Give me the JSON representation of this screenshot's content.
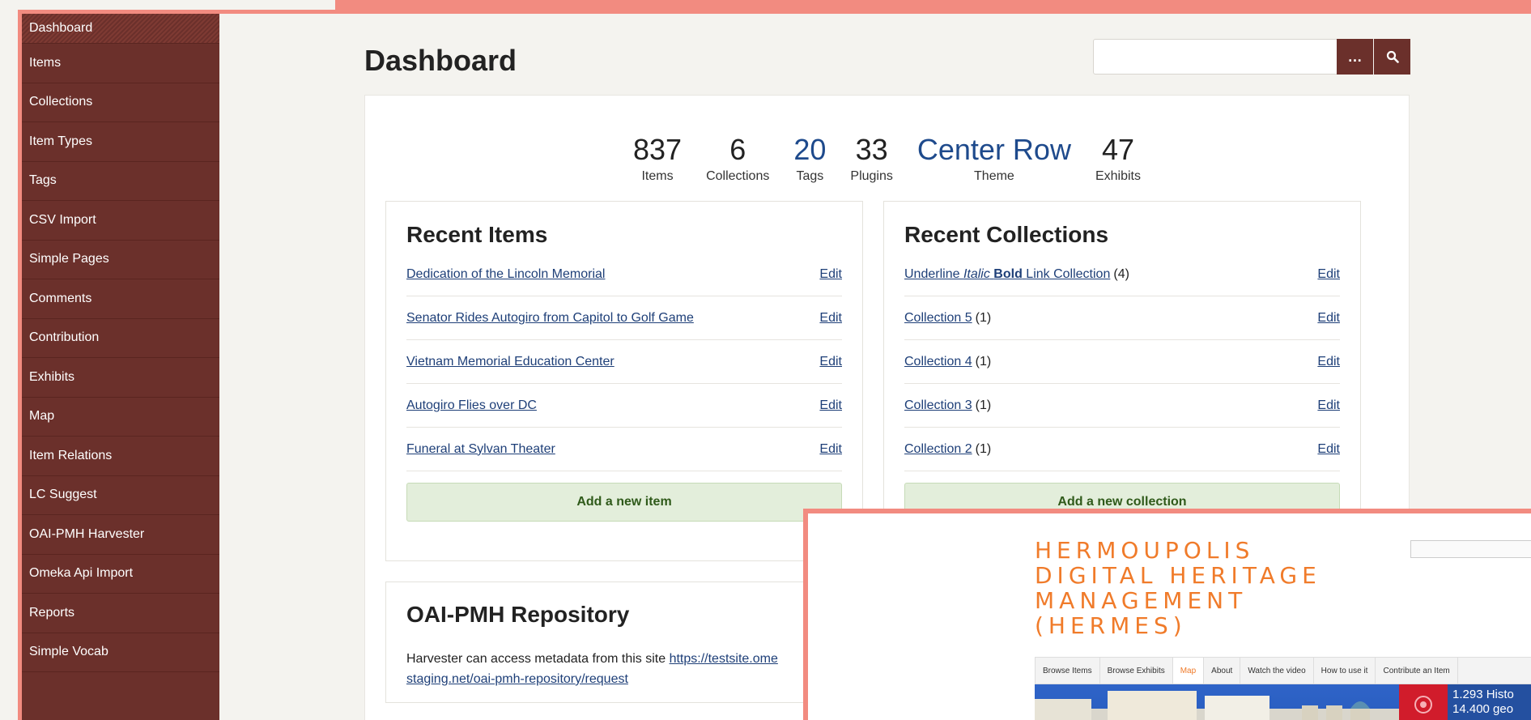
{
  "sidebar": {
    "items": [
      {
        "label": "Dashboard"
      },
      {
        "label": "Items"
      },
      {
        "label": "Collections"
      },
      {
        "label": "Item Types"
      },
      {
        "label": "Tags"
      },
      {
        "label": "CSV Import"
      },
      {
        "label": "Simple Pages"
      },
      {
        "label": "Comments"
      },
      {
        "label": "Contribution"
      },
      {
        "label": "Exhibits"
      },
      {
        "label": "Map"
      },
      {
        "label": "Item Relations"
      },
      {
        "label": "LC Suggest"
      },
      {
        "label": "OAI-PMH Harvester"
      },
      {
        "label": "Omeka Api Import"
      },
      {
        "label": "Reports"
      },
      {
        "label": "Simple Vocab"
      }
    ]
  },
  "header": {
    "title": "Dashboard",
    "search_value": "",
    "more_label": "…",
    "search_icon": "search-icon"
  },
  "stats": [
    {
      "value": "837",
      "label": "Items",
      "link": false
    },
    {
      "value": "6",
      "label": "Collections",
      "link": false
    },
    {
      "value": "20",
      "label": "Tags",
      "link": true
    },
    {
      "value": "33",
      "label": "Plugins",
      "link": false
    },
    {
      "value": "Center Row",
      "label": "Theme",
      "link": true
    },
    {
      "value": "47",
      "label": "Exhibits",
      "link": false
    }
  ],
  "recent_items": {
    "title": "Recent Items",
    "edit_label": "Edit",
    "items": [
      "Dedication of the Lincoln Memorial",
      "Senator Rides Autogiro from Capitol to Golf Game",
      "Vietnam Memorial Education Center",
      "Autogiro Flies over DC",
      "Funeral at Sylvan Theater"
    ],
    "add_label": "Add a new item"
  },
  "recent_collections": {
    "title": "Recent Collections",
    "edit_label": "Edit",
    "first": {
      "underline": "Underline",
      "italic": "Italic",
      "bold": "Bold",
      "rest": "Link Collection",
      "count": "(4)"
    },
    "items": [
      {
        "name": "Collection 5",
        "count": "(1)"
      },
      {
        "name": "Collection 4",
        "count": "(1)"
      },
      {
        "name": "Collection 3",
        "count": "(1)"
      },
      {
        "name": "Collection 2",
        "count": "(1)"
      }
    ],
    "add_label": "Add a new collection"
  },
  "oai": {
    "title": "OAI-PMH Repository",
    "text": "Harvester can access metadata from this site",
    "link_line1": "https://testsite.ome",
    "link_line2": "staging.net/oai-pmh-repository/request"
  },
  "overlay": {
    "title": "HERMOUPOLIS\nDIGITAL HERITAGE\nMANAGEMENT\n(HERMES)",
    "nav": [
      "Browse Items",
      "Browse Exhibits",
      "Map",
      "About",
      "Watch the video",
      "How to use it",
      "Contribute an Item"
    ],
    "active_nav": "Map",
    "stats_line1": "1.293 Histo",
    "stats_line2": "14.400 geo"
  },
  "colors": {
    "sidebar_bg": "#6b302b",
    "accent_salmon": "#f28b80",
    "link_blue": "#1e4a8c",
    "add_green": "#e3eedb",
    "hermes_orange": "#f07b2a"
  }
}
